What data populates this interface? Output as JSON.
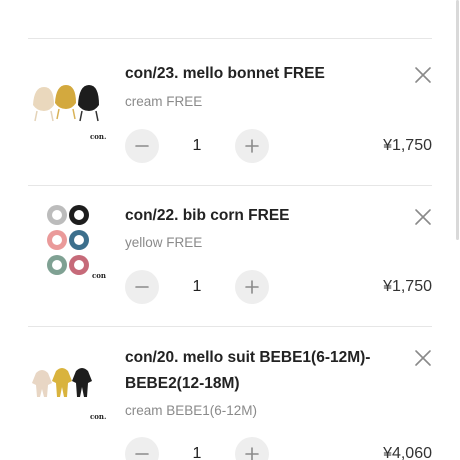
{
  "cart": {
    "items": [
      {
        "title": "con/23. mello bonnet FREE",
        "variant": "cream FREE",
        "quantity": "1",
        "price": "¥1,750",
        "thumb_mark": "con."
      },
      {
        "title": "con/22. bib corn FREE",
        "variant": "yellow FREE",
        "quantity": "1",
        "price": "¥1,750",
        "thumb_mark": "con."
      },
      {
        "title": "con/20. mello suit BEBE1(6-12M)-BEBE2(12-18M)",
        "variant": "cream BEBE1(6-12M)",
        "quantity": "1",
        "price": "¥4,060",
        "thumb_mark": "con."
      }
    ]
  },
  "icons": {
    "remove": "close-icon",
    "decrement": "minus-icon",
    "increment": "plus-icon"
  },
  "colors": {
    "divider": "#e6e6e6",
    "button_bg": "#eeeeee",
    "variant_text": "#8a8a8a",
    "icon_stroke": "#8a8a8a"
  }
}
